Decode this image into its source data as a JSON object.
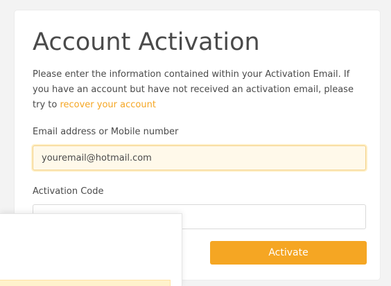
{
  "title": "Account Activation",
  "description": {
    "text": "Please enter the information contained within your Activation Email. If you have an account but have not received an activation email, please try to ",
    "link": "recover your account"
  },
  "fields": {
    "email_label": "Email address or Mobile number",
    "email_value": "youremail@hotmail.com",
    "code_label": "Activation Code",
    "code_value": ""
  },
  "actions": {
    "activate_label": "Activate"
  },
  "colors": {
    "accent": "#f5a623",
    "background": "#f3f3f3",
    "card": "#ffffff"
  }
}
